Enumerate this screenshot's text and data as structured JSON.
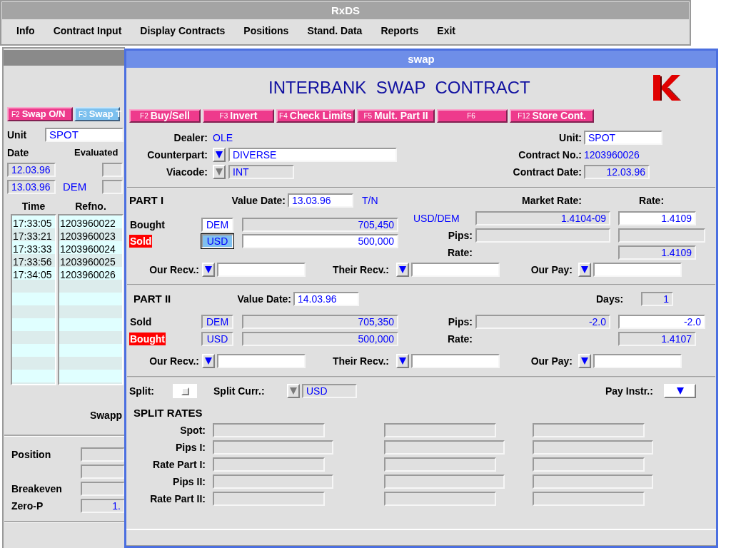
{
  "main_window": {
    "title": "RxDS",
    "menu": [
      {
        "label": "Info"
      },
      {
        "label": "Contract Input"
      },
      {
        "label": "Display Contracts"
      },
      {
        "label": "Positions"
      },
      {
        "label": "Stand. Data"
      },
      {
        "label": "Reports"
      },
      {
        "label": "Exit"
      }
    ]
  },
  "back_window": {
    "tabs": [
      {
        "key": "F2",
        "label": "Swap O/N",
        "selected": true
      },
      {
        "key": "F3",
        "label": "Swap T",
        "selected": false
      }
    ],
    "unit_label": "Unit",
    "unit": {
      "value": "SPOT",
      "editable": true
    },
    "date_label": "Date",
    "evaluated_label": "Evaluated",
    "date_rows": [
      {
        "date": {
          "value": "12.03.96",
          "editable": false
        },
        "evaluated": {
          "editable": false
        }
      },
      {
        "date": {
          "value": "13.03.96",
          "editable": false
        },
        "currency": "DEM",
        "evaluated": {
          "editable": false
        }
      }
    ],
    "table": {
      "columns": [
        "Time",
        "Refno."
      ],
      "rows": [
        [
          "17:33:05",
          "1203960022"
        ],
        [
          "17:33:21",
          "1203960023"
        ],
        [
          "17:33:33",
          "1203960024"
        ],
        [
          "17:33:56",
          "1203960025"
        ],
        [
          "17:34:05",
          "1203960026"
        ]
      ]
    },
    "swapp_label": "Swapp",
    "summary": [
      {
        "label": "Position",
        "field": {
          "editable": false
        }
      },
      {
        "field": {
          "editable": false
        }
      },
      {
        "label": "Breakeven",
        "field": {
          "editable": false
        }
      },
      {
        "label": "Zero-P",
        "field": {
          "value": "1.",
          "editable": false
        }
      }
    ]
  },
  "swap_window": {
    "title": "swap",
    "heading": "INTERBANK  SWAP  CONTRACT",
    "function_keys": [
      {
        "key": "F2",
        "label": "Buy/Sell"
      },
      {
        "key": "F3",
        "label": "Invert"
      },
      {
        "key": "F4",
        "label": "Check Limits"
      },
      {
        "key": "F5",
        "label": "Mult. Part II"
      },
      {
        "key": "F6"
      },
      {
        "key": "F12",
        "label": "Store Cont."
      }
    ],
    "header": {
      "dealer_label": "Dealer:",
      "dealer": "OLE",
      "counterpart_label": "Counterpart:",
      "counterpart_dropdown": {
        "disabled": false
      },
      "counterpart": {
        "value": "DIVERSE",
        "editable": true
      },
      "viacode_label": "Viacode:",
      "viacode_dropdown": {
        "disabled": true
      },
      "viacode": {
        "value": "INT",
        "editable": false
      },
      "unit_label": "Unit:",
      "unit": {
        "value": "SPOT",
        "editable": true
      },
      "contract_no_label": "Contract No.:",
      "contract_no": "1203960026",
      "contract_date_label": "Contract Date:",
      "contract_date": {
        "value": "12.03.96",
        "editable": false
      }
    },
    "part_1": {
      "title": "PART I",
      "value_date_label": "Value Date:",
      "value_date": {
        "value": "13.03.96",
        "editable": true
      },
      "tenor": "T/N",
      "market_rate_label": "Market Rate:",
      "rate_label": "Rate:",
      "legs": [
        {
          "label": "Bought",
          "highlighted": false,
          "currency": {
            "value": "DEM",
            "editable": true,
            "selected": false
          },
          "amount": {
            "value": "705,450",
            "editable": false
          }
        },
        {
          "label": "Sold",
          "highlighted": true,
          "currency": {
            "value": "USD",
            "selected": true
          },
          "amount": {
            "value": "500,000",
            "editable": true
          }
        }
      ],
      "rates": [
        {
          "kind": "pair",
          "text": "USD/DEM",
          "field_a": {
            "value": "1.4104-09",
            "editable": false
          },
          "field_b": {
            "value": "1.4109",
            "editable": true
          }
        },
        {
          "kind": "label",
          "text": "Pips:",
          "field_a": {
            "editable": false
          },
          "field_b": {
            "editable": false
          },
          "wide": true
        },
        {
          "kind": "label",
          "text": "Rate:",
          "field_b": {
            "value": "1.4109",
            "editable": false
          }
        }
      ],
      "instructions": [
        {
          "label": "Our Recv.:",
          "dropdown": {
            "disabled": false
          },
          "field": {
            "editable": true
          }
        },
        {
          "label": "Their Recv.:",
          "dropdown": {
            "disabled": false
          },
          "field": {
            "editable": true
          }
        },
        {
          "label": "Our Pay:",
          "dropdown": {
            "disabled": false
          },
          "field": {
            "editable": true
          }
        }
      ]
    },
    "part_2": {
      "title": "PART II",
      "value_date_label": "Value Date:",
      "value_date": {
        "value": "14.03.96",
        "editable": true
      },
      "days_label": "Days:",
      "days": {
        "value": "1",
        "editable": false
      },
      "legs": [
        {
          "label": "Sold",
          "highlighted": false,
          "currency": {
            "value": "DEM",
            "editable": false,
            "selected": false
          },
          "amount": {
            "value": "705,350",
            "editable": false
          }
        },
        {
          "label": "Bought",
          "highlighted": true,
          "currency": {
            "value": "USD",
            "editable": false,
            "selected": false
          },
          "amount": {
            "value": "500,000",
            "editable": false
          }
        }
      ],
      "rates": [
        {
          "kind": "label",
          "text": "Pips:",
          "field_a": {
            "value": "-2.0",
            "editable": false
          },
          "field_b": {
            "value": "-2.0",
            "editable": true
          },
          "wide": true
        },
        {
          "kind": "label",
          "text": "Rate:",
          "field_b": {
            "value": "1.4107",
            "editable": false
          }
        }
      ],
      "instructions": [
        {
          "label": "Our Recv.:",
          "dropdown": {
            "disabled": false
          },
          "field": {
            "editable": true
          }
        },
        {
          "label": "Their Recv.:",
          "dropdown": {
            "disabled": false
          },
          "field": {
            "editable": true
          }
        },
        {
          "label": "Our Pay:",
          "dropdown": {
            "disabled": false
          },
          "field": {
            "editable": true
          }
        }
      ]
    },
    "split": {
      "split_label": "Split:",
      "checked": false,
      "split_currency_label": "Split Curr.:",
      "split_currency_dropdown": {
        "disabled": true
      },
      "split_currency": {
        "value": "USD",
        "editable": false
      },
      "pay_instr_label": "Pay Instr.:",
      "pay_instr_dropdown": {
        "disabled": false
      }
    },
    "split_rates": {
      "title": "SPLIT RATES",
      "rows": [
        {
          "label": "Spot:",
          "wide": false
        },
        {
          "label": "Pips I:",
          "wide": true
        },
        {
          "label": "Rate Part I:",
          "wide": false
        },
        {
          "label": "Pips II:",
          "wide": true
        },
        {
          "label": "Rate Part II:",
          "wide": false
        }
      ]
    }
  }
}
